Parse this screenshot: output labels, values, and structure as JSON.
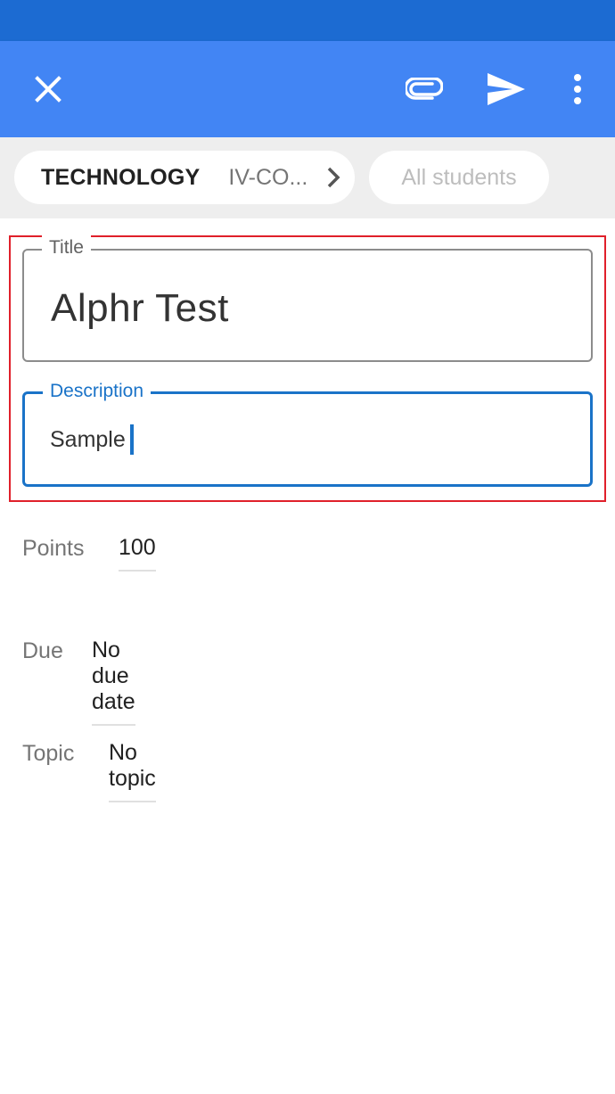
{
  "header": {
    "close_icon": "close-icon",
    "attach_icon": "paperclip-icon",
    "send_icon": "send-icon",
    "more_icon": "more-vert-icon",
    "bar_color": "#4285f4",
    "status_color": "#1c6bd2"
  },
  "audience": {
    "class_name": "TECHNOLOGY",
    "section": "IV-CO...",
    "students": "All students"
  },
  "form": {
    "title_label": "Title",
    "title_value": "Alphr Test",
    "description_label": "Description",
    "description_value": "Sample"
  },
  "details": {
    "points_label": "Points",
    "points_value": "100",
    "due_label": "Due",
    "due_value": "No due date",
    "topic_label": "Topic",
    "topic_value": "No topic"
  },
  "colors": {
    "accent": "#1a73c8",
    "highlight": "#e0202a"
  }
}
